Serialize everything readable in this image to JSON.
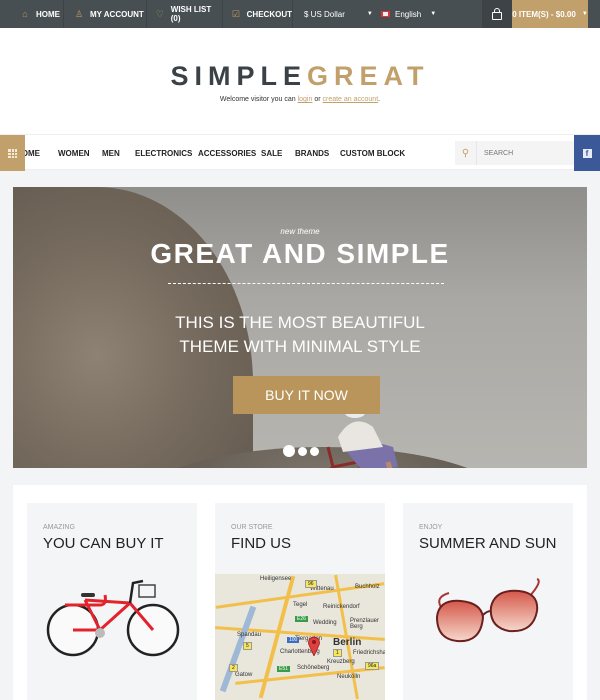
{
  "topbar": {
    "links": [
      {
        "label": "HOME",
        "icon": "home-icon"
      },
      {
        "label": "MY ACCOUNT",
        "icon": "user-icon"
      },
      {
        "label": "WISH LIST (0)",
        "icon": "heart-icon"
      },
      {
        "label": "CHECKOUT",
        "icon": "checkout-icon"
      }
    ],
    "currency": "$ US Dollar",
    "language": "English",
    "cart": "0 ITEM(S) - $0.00"
  },
  "header": {
    "logo_part1": "SIMPLE",
    "logo_part2": "GREAT",
    "welcome_prefix": "Welcome visitor you can ",
    "login_link": "login",
    "welcome_middle": " or ",
    "create_link": "create an account",
    "welcome_suffix": "."
  },
  "nav": {
    "items": [
      "HOME",
      "WOMEN",
      "MEN",
      "ELECTRONICS",
      "ACCESSORIES",
      "SALE",
      "BRANDS",
      "CUSTOM BLOCK"
    ],
    "search_placeholder": "SEARCH",
    "facebook": "f"
  },
  "slider": {
    "subtitle": "new theme",
    "title": "GREAT AND SIMPLE",
    "text_line1": "THIS IS THE MOST BEAUTIFUL",
    "text_line2": "THEME WITH MINIMAL STYLE",
    "button": "BUY IT NOW",
    "prev": "‹",
    "next": "›",
    "slides": 3,
    "active_slide": 1
  },
  "features": [
    {
      "pretitle": "AMAZING",
      "title": "YOU CAN BUY IT",
      "image": "red-bicycle"
    },
    {
      "pretitle": "OUR STORE",
      "title": "FIND US",
      "image": "berlin-map"
    },
    {
      "pretitle": "ENJOY",
      "title": "SUMMER AND SUN",
      "image": "sunglasses"
    }
  ],
  "map": {
    "labels": [
      "Heiligensee",
      "Wittenau",
      "Buchholz",
      "Tegel",
      "Reinickendorf",
      "Wedding",
      "Prenzlauer Berg",
      "Spandau",
      "Tiergarten",
      "Berlin",
      "Charlottenburg",
      "Friedrichshain",
      "Kreuzberg",
      "Schöneberg",
      "Gatow",
      "Neukölln"
    ],
    "route_numbers": [
      "96",
      "E26",
      "100",
      "5",
      "2",
      "1",
      "E51",
      "96a"
    ]
  },
  "colors": {
    "accent": "#c2a06c",
    "topbar": "#484f53",
    "facebook": "#3b5998"
  }
}
